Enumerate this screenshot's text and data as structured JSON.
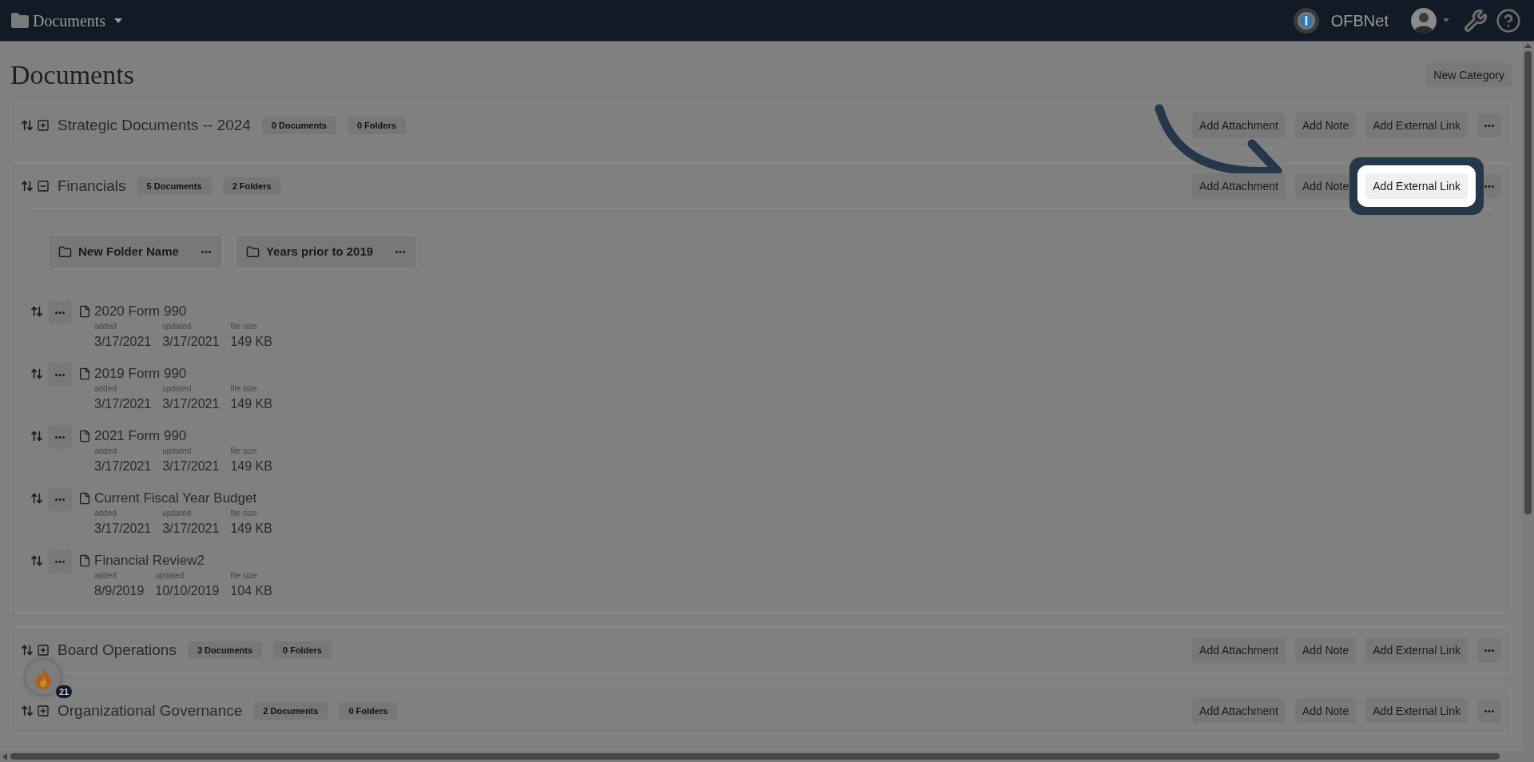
{
  "topbar": {
    "section": "Documents",
    "org": "OFBNet"
  },
  "page_title": "Documents",
  "new_category": "New Category",
  "categories": [
    {
      "name": "Strategic Documents -- 2024",
      "expanded": false,
      "documents_badge": "0 Documents",
      "folders_badge": "0 Folders",
      "actions": [
        {
          "label": "Add Attachment",
          "highlighted": false
        },
        {
          "label": "Add Note",
          "highlighted": false
        },
        {
          "label": "Add External Link",
          "highlighted": false
        }
      ]
    },
    {
      "name": "Financials",
      "expanded": true,
      "documents_badge": "5 Documents",
      "folders_badge": "2 Folders",
      "actions": [
        {
          "label": "Add Attachment",
          "highlighted": false
        },
        {
          "label": "Add Note",
          "highlighted": false
        },
        {
          "label": "Add External Link",
          "highlighted": true
        }
      ],
      "folders": [
        {
          "name": "New Folder Name"
        },
        {
          "name": "Years prior to 2019"
        }
      ],
      "documents": [
        {
          "name": "2020 Form 990",
          "added_label": "added",
          "added": "3/17/2021",
          "updated_label": "updated",
          "updated": "3/17/2021",
          "size_label": "file size",
          "size": "149 KB"
        },
        {
          "name": "2019 Form 990",
          "added_label": "added",
          "added": "3/17/2021",
          "updated_label": "updated",
          "updated": "3/17/2021",
          "size_label": "file size",
          "size": "149 KB"
        },
        {
          "name": "2021 Form 990",
          "added_label": "added",
          "added": "3/17/2021",
          "updated_label": "updated",
          "updated": "3/17/2021",
          "size_label": "file size",
          "size": "149 KB"
        },
        {
          "name": "Current Fiscal Year Budget",
          "added_label": "added",
          "added": "3/17/2021",
          "updated_label": "updated",
          "updated": "3/17/2021",
          "size_label": "file size",
          "size": "149 KB"
        },
        {
          "name": "Financial Review2",
          "added_label": "added",
          "added": "8/9/2019",
          "updated_label": "updated",
          "updated": "10/10/2019",
          "size_label": "file size",
          "size": "104 KB"
        }
      ]
    },
    {
      "name": "Board Operations",
      "expanded": false,
      "documents_badge": "3 Documents",
      "folders_badge": "0 Folders",
      "actions": [
        {
          "label": "Add Attachment",
          "highlighted": false
        },
        {
          "label": "Add Note",
          "highlighted": false
        },
        {
          "label": "Add External Link",
          "highlighted": false
        }
      ]
    },
    {
      "name": "Organizational Governance",
      "expanded": false,
      "documents_badge": "2 Documents",
      "folders_badge": "0 Folders",
      "actions": [
        {
          "label": "Add Attachment",
          "highlighted": false
        },
        {
          "label": "Add Note",
          "highlighted": false
        },
        {
          "label": "Add External Link",
          "highlighted": false
        }
      ]
    }
  ],
  "notification_badge": "21"
}
